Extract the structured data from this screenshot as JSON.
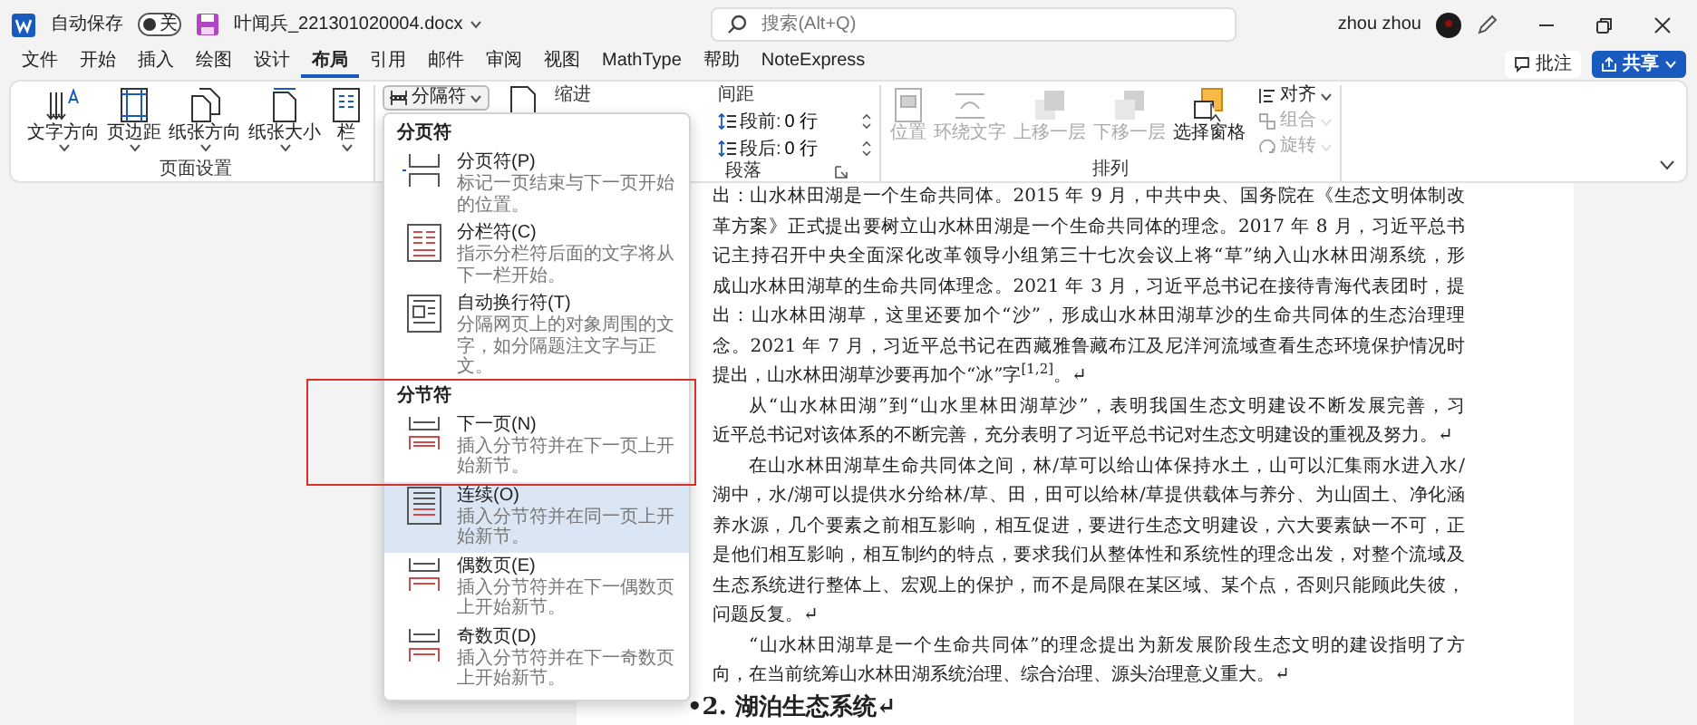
{
  "title_bar": {
    "autosave_label": "自动保存",
    "autosave_on": false,
    "autosave_state": "关",
    "filename": "叶闻兵_221301020004.docx",
    "search_placeholder": "搜索(Alt+Q)",
    "user": "zhou zhou"
  },
  "menu_tabs": [
    {
      "label": "文件",
      "selected": false
    },
    {
      "label": "开始",
      "selected": false
    },
    {
      "label": "插入",
      "selected": false
    },
    {
      "label": "绘图",
      "selected": false
    },
    {
      "label": "设计",
      "selected": false
    },
    {
      "label": "布局",
      "selected": true
    },
    {
      "label": "引用",
      "selected": false
    },
    {
      "label": "邮件",
      "selected": false
    },
    {
      "label": "审阅",
      "selected": false
    },
    {
      "label": "视图",
      "selected": false
    },
    {
      "label": "MathType",
      "selected": false
    },
    {
      "label": "帮助",
      "selected": false
    },
    {
      "label": "NoteExpress",
      "selected": false
    }
  ],
  "actions": [
    {
      "label": "批注",
      "kind": "comment"
    },
    {
      "label": "共享",
      "kind": "share"
    }
  ],
  "ribbon": {
    "page_setup": {
      "buttons": [
        {
          "label": "文字方向"
        },
        {
          "label": "页边距"
        },
        {
          "label": "纸张方向"
        },
        {
          "label": "纸张大小"
        },
        {
          "label": "栏"
        }
      ],
      "group_label": "页面设置"
    },
    "breaks_button": "分隔符",
    "indent_label": "缩进",
    "spacing_label": "间距",
    "spacing_fields": [
      {
        "label": "段前:",
        "value": "0 行"
      },
      {
        "label": "段后:",
        "value": "0 行"
      }
    ],
    "paragraph_label": "段落",
    "arrange": {
      "buttons": [
        {
          "label": "位置",
          "disabled": true
        },
        {
          "label": "环绕文字",
          "disabled": true
        },
        {
          "label": "上移一层",
          "disabled": true
        },
        {
          "label": "下移一层",
          "disabled": true
        },
        {
          "label": "选择窗格",
          "disabled": false
        }
      ],
      "small_buttons": [
        {
          "label": "对齐",
          "disabled": false
        },
        {
          "label": "组合",
          "disabled": true
        },
        {
          "label": "旋转",
          "disabled": true
        }
      ],
      "group_label": "排列"
    }
  },
  "breaks_menu": {
    "annotation_frame": true,
    "sections": [
      {
        "header": "分页符",
        "items": [
          {
            "kind": "page",
            "title": "分页符(P)",
            "description": "标记一页结束与下一页开始的位置。",
            "selected": false
          },
          {
            "kind": "column",
            "title": "分栏符(C)",
            "description": "指示分栏符后面的文字将从下一栏开始。",
            "selected": false
          },
          {
            "kind": "wrap",
            "title": "自动换行符(T)",
            "description": "分隔网页上的对象周围的文字，如分隔题注文字与正文。",
            "selected": false
          }
        ]
      },
      {
        "header": "分节符",
        "items": [
          {
            "kind": "next",
            "title": "下一页(N)",
            "description": "插入分节符并在下一页上开始新节。",
            "selected": false
          },
          {
            "kind": "continuous",
            "title": "连续(O)",
            "description": "插入分节符并在同一页上开始新节。",
            "selected": true
          },
          {
            "kind": "even",
            "title": "偶数页(E)",
            "description": "插入分节符并在下一偶数页上开始新节。",
            "selected": false
          },
          {
            "kind": "odd",
            "title": "奇数页(D)",
            "description": "插入分节符并在下一奇数页上开始新节。",
            "selected": false
          }
        ]
      }
    ]
  },
  "document": {
    "paragraphs": [
      {
        "indent": false,
        "lines": [
          "出：山水林田湖是一个生命共同体。2015 年 9 月，中共中央、国务院在《生态文明体制改",
          "革方案》正式提出要树立山水林田湖是一个生命共同体的理念。2017 年 8 月，习近平总书",
          "记主持召开中央全面深化改革领导小组第三十七次会议上将“草”纳入山水林田湖系统，形",
          "成山水林田湖草的生命共同体理念。2021 年 3 月，习近平总书记在接待青海代表团时，提",
          "出：山水林田湖草，这里还要加个“沙”，形成山水林田湖草沙的生命共同体的生态治理理",
          "念。2021 年 7 月，习近平总书记在西藏雅鲁藏布江及尼洋河流域查看生态环境保护情况时",
          "提出，山水林田湖草沙要再加个“冰”字$^{[1,2]}$。↵"
        ]
      },
      {
        "indent": true,
        "lines": [
          "从“山水林田湖”到“山水里林田湖草沙”，表明我国生态文明建设不断发展完善，习",
          "近平总书记对该体系的不断完善，充分表明了习近平总书记对生态文明建设的重视及努力。↵"
        ]
      },
      {
        "indent": true,
        "lines": [
          "在山水林田湖草生命共同体之间，林/草可以给山体保持水土，山可以汇集雨水进入水/",
          "湖中，水/湖可以提供水分给林/草、田，田可以给林/草提供载体与养分、为山固土、净化涵",
          "养水源，几个要素之前相互影响，相互促进，要进行生态文明建设，六大要素缺一不可，正",
          "是他们相互影响，相互制约的特点，要求我们从整体性和系统性的理念出发，对整个流域及",
          "生态系统进行整体上、宏观上的保护，而不是局限在某区域、某个点，否则只能顾此失彼，",
          "问题反复。↵"
        ]
      },
      {
        "indent": true,
        "lines": [
          "“山水林田湖草是一个生命共同体”的理念提出为新发展阶段生态文明的建设指明了方",
          "向，在当前统筹山水林田湖系统治理、综合治理、源头治理意义重大。↵"
        ]
      }
    ],
    "heading": "•2. 湖泊生态系统↵"
  }
}
